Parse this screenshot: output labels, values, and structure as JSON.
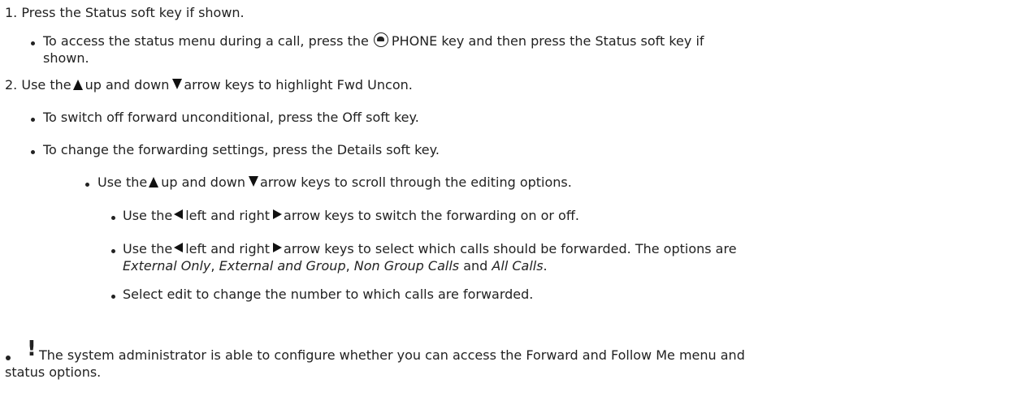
{
  "steps": [
    {
      "number": "1.",
      "text": "Press the Status soft key if shown.",
      "sub": [
        {
          "l1_a": "To access the status menu during a call, press the",
          "l1_icon": "phone-icon",
          "l1_b": "PHONE key and then press the Status soft key if",
          "l2": "shown."
        }
      ]
    },
    {
      "number": "2.",
      "text_a": "Use the",
      "text_b": "up and down",
      "text_c": "arrow keys to highlight Fwd Uncon.",
      "sub": [
        {
          "text": "To switch off forward unconditional, press the Off soft key."
        },
        {
          "text": "To change the forwarding settings, press the Details soft key."
        }
      ],
      "level3": {
        "text_a": "Use the",
        "text_b": "up and down",
        "text_c": "arrow keys to scroll through the editing options."
      },
      "level4": [
        {
          "a": "Use the",
          "b": "left and right",
          "c": "arrow keys to switch the forwarding on or off."
        },
        {
          "a": "Use the",
          "b": "left and right",
          "c": "arrow keys to select which calls should be forwarded. The options are",
          "opt1": "External Only",
          "sep1": ",",
          "opt2": "External and Group",
          "sep2": ",",
          "opt3": "Non Group Calls",
          "and": "and",
          "opt4": "All Calls",
          "end": "."
        },
        {
          "text": "Select edit to change the number to which calls are forwarded."
        }
      ]
    }
  ],
  "note": {
    "icon": "!",
    "line1": "The system administrator is able to configure whether you can access the Forward and Follow Me menu and",
    "line2": "status options."
  },
  "icons": {
    "up": "up-arrow-icon",
    "down": "down-arrow-icon",
    "left": "left-arrow-icon",
    "right": "right-arrow-icon",
    "phone": "phone-icon",
    "warning": "exclamation-icon"
  }
}
